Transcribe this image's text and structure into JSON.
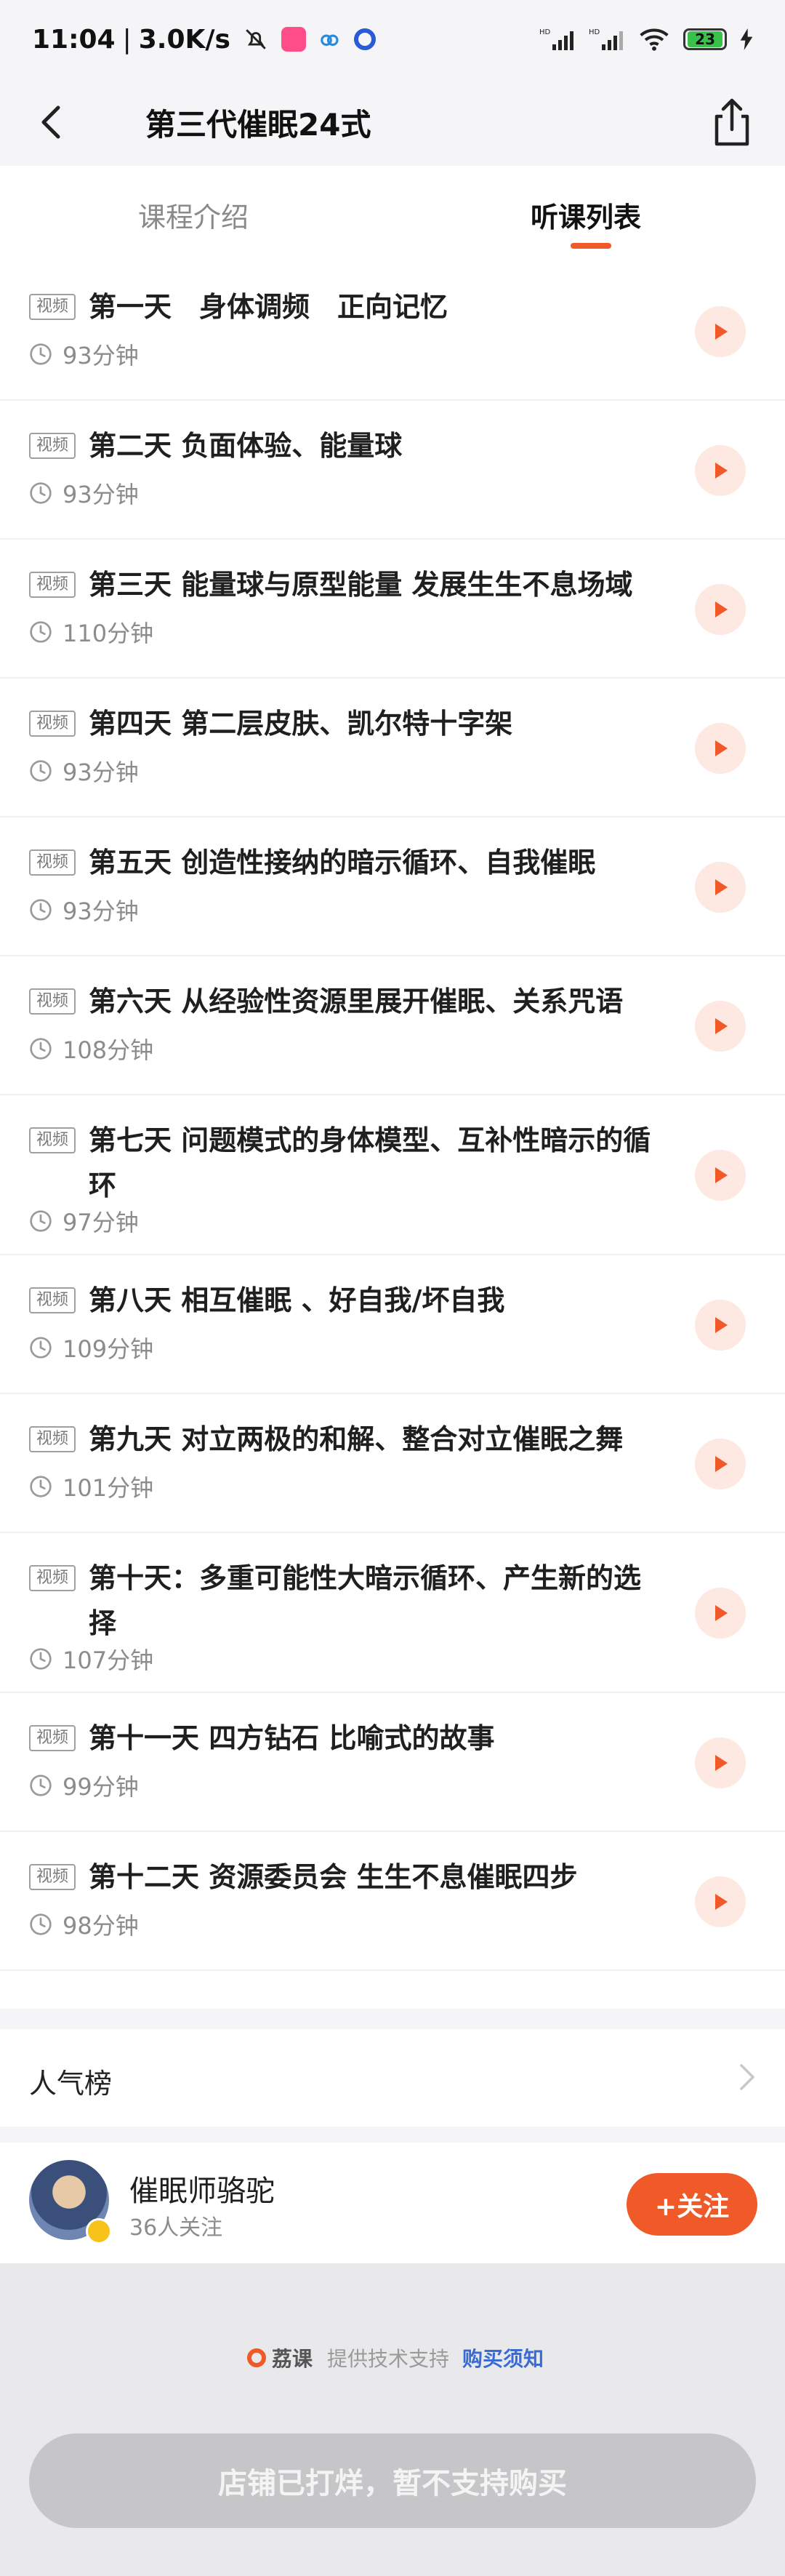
{
  "status_bar": {
    "time": "11:04",
    "speed": "3.0K/s",
    "battery": "23"
  },
  "nav": {
    "title": "第三代催眠24式"
  },
  "tabs": [
    {
      "label": "课程介绍",
      "active": false
    },
    {
      "label": "听课列表",
      "active": true
    }
  ],
  "lesson_tag": "视频",
  "lessons": [
    {
      "title": "第一天　身体调频　正向记忆",
      "duration": "93分钟"
    },
    {
      "title": "第二天 负面体验、能量球",
      "duration": "93分钟"
    },
    {
      "title": "第三天 能量球与原型能量  发展生生不息场域",
      "duration": "110分钟"
    },
    {
      "title": "第四天 第二层皮肤、凯尔特十字架",
      "duration": "93分钟"
    },
    {
      "title": "第五天 创造性接纳的暗示循环、自我催眠",
      "duration": "93分钟"
    },
    {
      "title": "第六天 从经验性资源里展开催眠、关系咒语",
      "duration": "108分钟"
    },
    {
      "title": "第七天 问题模式的身体模型、互补性暗示的循环",
      "duration": "97分钟"
    },
    {
      "title": "第八天 相互催眠 、好自我/坏自我",
      "duration": "109分钟"
    },
    {
      "title": "第九天  对立两极的和解、整合对立催眠之舞",
      "duration": "101分钟"
    },
    {
      "title": "第十天：多重可能性大暗示循环、产生新的选择",
      "duration": "107分钟"
    },
    {
      "title": "第十一天  四方钻石  比喻式的故事",
      "duration": "99分钟"
    },
    {
      "title": "第十二天  资源委员会  生生不息催眠四步",
      "duration": "98分钟"
    }
  ],
  "popular": {
    "label": "人气榜"
  },
  "teacher": {
    "name": "催眠师骆驼",
    "followers": "36人关注",
    "follow_label": "+关注"
  },
  "footer": {
    "brand": "荔课",
    "support_text": "提供技术支持",
    "purchase_notice": "购买须知",
    "buy_button": "店铺已打烊，暂不支持购买"
  },
  "colors": {
    "accent": "#f05a28",
    "play_bg": "#fde9e1"
  }
}
